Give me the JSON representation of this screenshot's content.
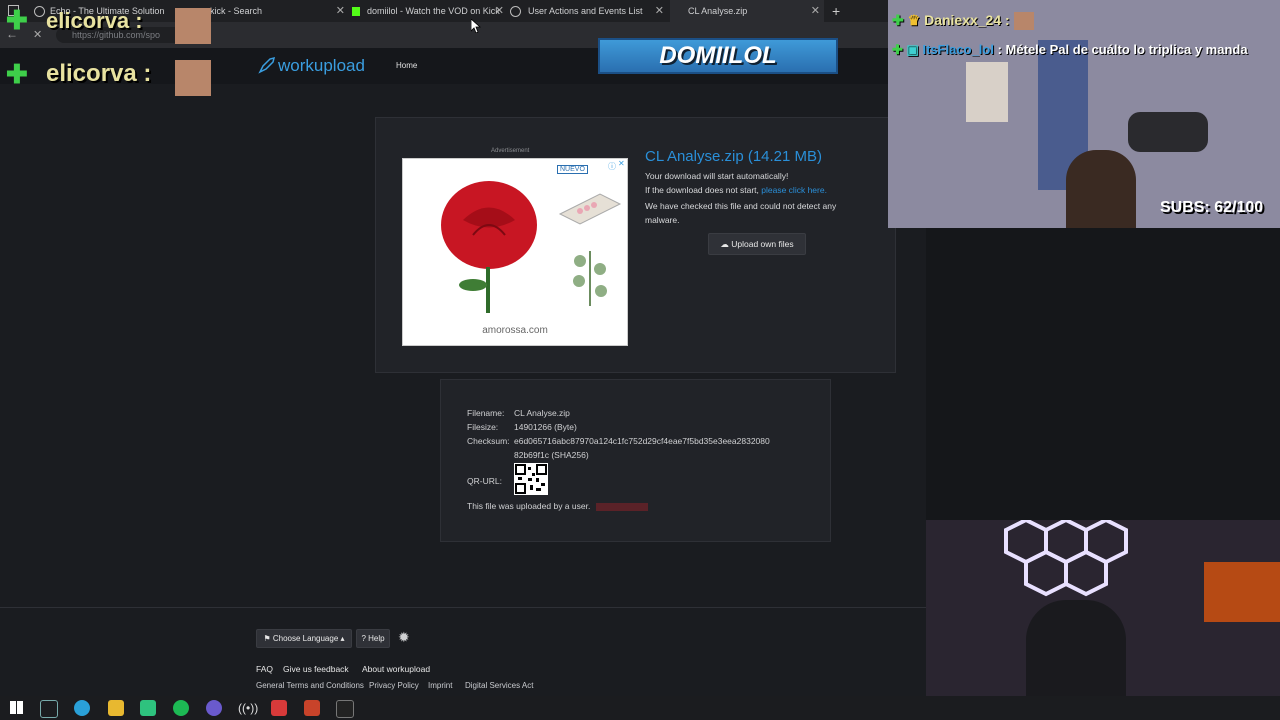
{
  "browser": {
    "tabs": [
      {
        "label": "Echo - The Ultimate Solution"
      },
      {
        "label": "kick - Search"
      },
      {
        "label": "domiilol - Watch the VOD on Kick"
      },
      {
        "label": "User Actions and Events List"
      },
      {
        "label": "CL Analyse.zip"
      }
    ],
    "url": "https://github.com/spo"
  },
  "overlay": {
    "chat_user_top": "elicorva :",
    "chat_user_main": "elicorva :",
    "stream_banner": "DOMIILOL",
    "chat_lines": [
      {
        "user": "Daniexx_24 :",
        "message": ""
      },
      {
        "user": "ItsFlaco_lol",
        "message": ": Métele Pal de cuálto lo triplica y manda"
      }
    ],
    "subs": "SUBS: 62/100"
  },
  "site": {
    "logo": "workupload",
    "nav_home": "Home",
    "ad_label": "Advertisement",
    "ad_badge": "NUEVO",
    "ad_domain": "amorossa.com",
    "file_title": "CL Analyse.zip (14.21 MB)",
    "download_msg1": "Your download will start automatically!",
    "download_msg2": "If the download does not start,",
    "download_link": "please click here.",
    "download_msg3": "We have checked this file and could not detect any malware.",
    "upload_btn": "Upload own files",
    "details": {
      "filename_label": "Filename:",
      "filename": "CL Analyse.zip",
      "filesize_label": "Filesize:",
      "filesize": "14901266 (Byte)",
      "checksum_label": "Checksum:",
      "checksum_line1": "e6d065716abc87970a124c1fc752d29cf4eae7f5bd35e3eea2832080",
      "checksum_line2": "82b69f1c (SHA256)",
      "qr_label": "QR-URL:",
      "uploaded_by": "This file was uploaded by a user."
    },
    "footer": {
      "language_btn": "Choose Language",
      "help_btn": "? Help",
      "faq": "FAQ",
      "feedback": "Give us feedback",
      "about": "About workupload",
      "terms": "General Terms and Conditions",
      "privacy": "Privacy Policy",
      "imprint": "Imprint",
      "dsa": "Digital Services Act"
    }
  },
  "colors": {
    "accent_blue": "#2a8fd8",
    "page_bg": "#1a1c20",
    "panel_bg": "#212328",
    "chat_green": "#3ecf4a"
  }
}
